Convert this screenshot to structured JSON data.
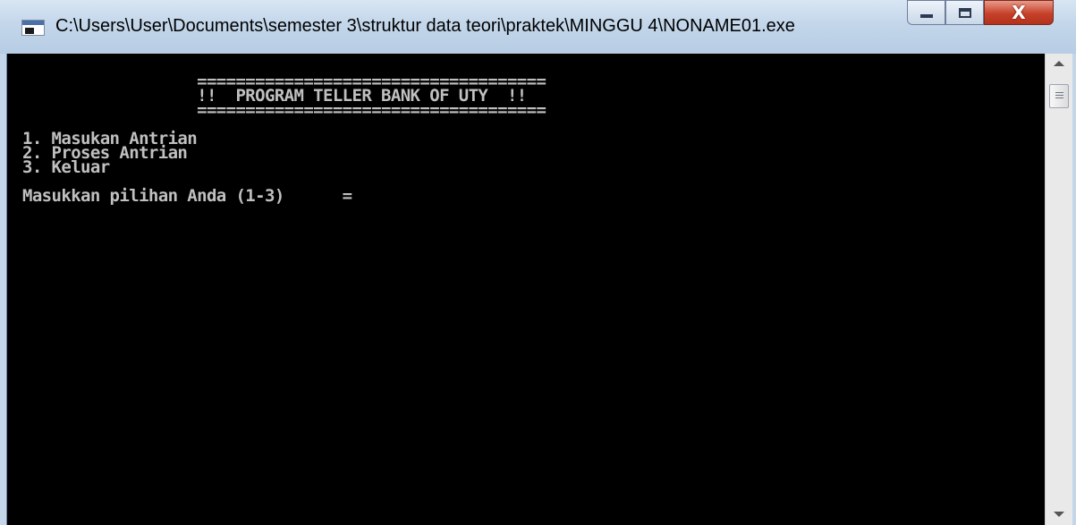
{
  "window": {
    "title": "C:\\Users\\User\\Documents\\semester 3\\struktur data teori\\praktek\\MINGGU 4\\NONAME01.exe",
    "controls": {
      "minimize": "minimize-icon",
      "maximize": "maximize-icon",
      "close": "X"
    }
  },
  "console": {
    "lines": [
      "                  ====================================",
      "                  !!  PROGRAM TELLER BANK OF UTY  !!",
      "                  ====================================",
      "",
      "1. Masukan Antrian",
      "2. Proses Antrian",
      "3. Keluar",
      "",
      "Masukkan pilihan Anda (1-3)      ="
    ]
  },
  "colors": {
    "console_bg": "#000000",
    "console_text": "#c0c0c0",
    "titlebar": "#c3d6ea"
  }
}
